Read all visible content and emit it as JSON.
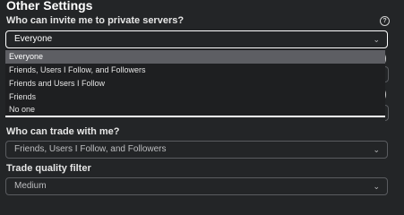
{
  "section_title": "Other Settings",
  "invite": {
    "label": "Who can invite me to private servers?",
    "value": "Everyone",
    "options": [
      "Everyone",
      "Friends, Users I Follow, and Followers",
      "Friends and Users I Follow",
      "Friends",
      "No one"
    ]
  },
  "trade": {
    "label": "Who can trade with me?",
    "value": "Friends, Users I Follow, and Followers"
  },
  "trade_filter": {
    "label": "Trade quality filter",
    "value": "Medium"
  },
  "icons": {
    "help": "?",
    "chevron": "⌄"
  }
}
